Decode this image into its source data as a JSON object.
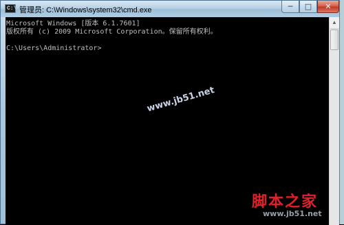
{
  "window": {
    "title": "管理员: C:\\Windows\\system32\\cmd.exe",
    "app_icon_glyph": "C:\\",
    "minimize_glyph": "─",
    "maximize_glyph": "□",
    "close_glyph": "✕"
  },
  "console": {
    "lines": [
      "Microsoft Windows [版本 6.1.7601]",
      "版权所有 (c) 2009 Microsoft Corporation。保留所有权利。",
      "",
      "C:\\Users\\Administrator>"
    ]
  },
  "scrollbar": {
    "up_glyph": "▲"
  },
  "watermark": {
    "text": "www.jb51.net"
  },
  "logo": {
    "text": "脚本之家",
    "url": "www.jb51.net"
  }
}
